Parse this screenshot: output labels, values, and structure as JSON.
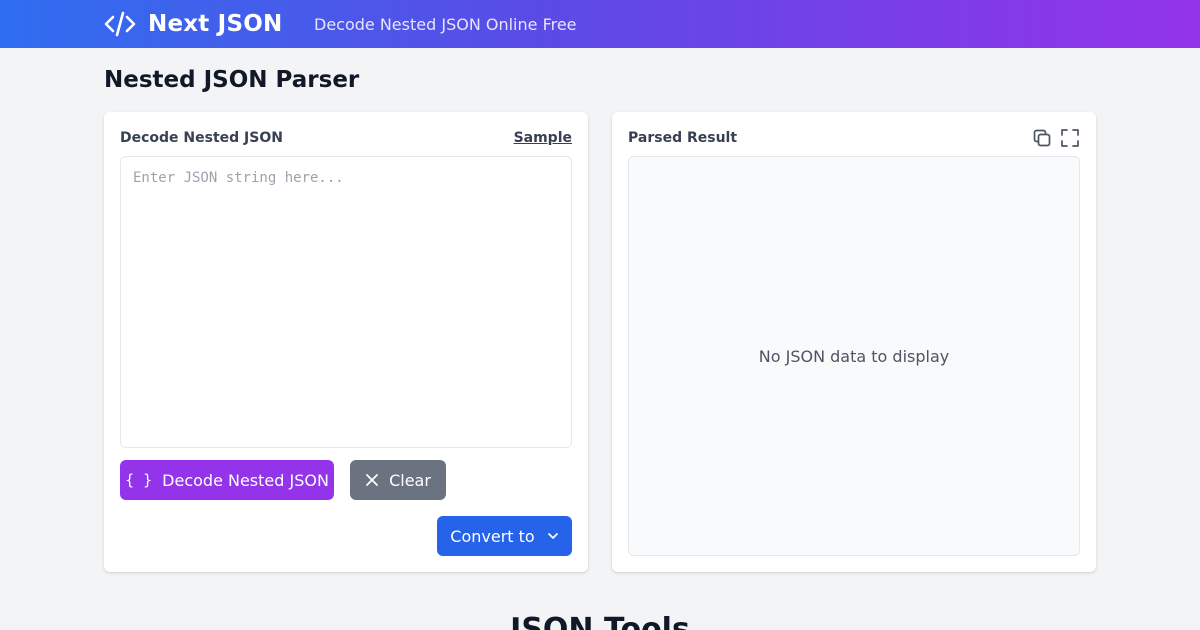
{
  "header": {
    "brand_name": "Next JSON",
    "tagline": "Decode Nested JSON Online Free",
    "logo_icon": "code-icon"
  },
  "page": {
    "title": "Nested JSON Parser",
    "next_section_title": "JSON Tools"
  },
  "input_panel": {
    "label": "Decode Nested JSON",
    "sample_link": "Sample",
    "input_value": "",
    "placeholder": "Enter JSON string here...",
    "decode_button": "Decode Nested JSON",
    "decode_icon": "{ }",
    "clear_button": "Clear",
    "convert_button": "Convert to"
  },
  "result_panel": {
    "label": "Parsed Result",
    "empty_message": "No JSON data to display",
    "copy_icon": "copy-icon",
    "fullscreen_icon": "fullscreen-icon"
  },
  "colors": {
    "header_gradient_start": "#2f6ef0",
    "header_gradient_end": "#9333ea",
    "decode_button": "#9333ea",
    "clear_button": "#6b7280",
    "convert_button": "#2563eb",
    "background": "#f3f4f6"
  }
}
